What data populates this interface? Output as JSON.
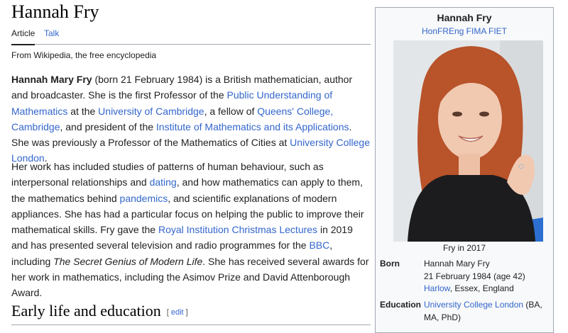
{
  "article": {
    "title": "Hannah Fry",
    "tabs": {
      "article": "Article",
      "talk": "Talk"
    },
    "tagline": "From Wikipedia, the free encyclopedia"
  },
  "p1": [
    {
      "t": "Hannah Mary Fry",
      "b": true
    },
    {
      "t": " (born 21 February 1984) is a British mathematician, author and broadcaster. She is the first Professor of the "
    },
    {
      "t": "Public Understanding of Mathematics",
      "link": true
    },
    {
      "t": " at the "
    },
    {
      "t": "University of Cambridge",
      "link": true
    },
    {
      "t": ", a fellow of "
    },
    {
      "t": "Queens' College, Cambridge",
      "link": true
    },
    {
      "t": ", and president of the "
    },
    {
      "t": "Institute of Mathematics and its Applications",
      "link": true
    },
    {
      "t": ". She was previously a Professor of the Mathematics of Cities at "
    },
    {
      "t": "University College London",
      "link": true
    },
    {
      "t": "."
    }
  ],
  "p2": [
    {
      "t": "Her work has included studies of patterns of human behaviour, such as interpersonal relationships and "
    },
    {
      "t": "dating",
      "link": true
    },
    {
      "t": ", and how mathematics can apply to them, the mathematics behind "
    },
    {
      "t": "pandemics",
      "link": true
    },
    {
      "t": ", and scientific explanations of modern appliances. She has had a particular focus on helping the public to improve their mathematical skills. Fry gave the "
    },
    {
      "t": "Royal Institution Christmas Lectures",
      "link": true
    },
    {
      "t": " in 2019 and has presented several television and radio programmes for the "
    },
    {
      "t": "BBC",
      "link": true
    },
    {
      "t": ", including "
    },
    {
      "t": "The Secret Genius of Modern Life",
      "i": true
    },
    {
      "t": ". She has received several awards for her work in mathematics, including the Asimov Prize and David Attenborough Award."
    }
  ],
  "section": {
    "title": "Early life and education",
    "edit_open": "[ ",
    "edit": "edit",
    "edit_close": " ]"
  },
  "infobox": {
    "name": "Hannah Fry",
    "honors": "HonFREng FIMA FIET",
    "caption": "Fry in 2017",
    "born_label": "Born",
    "born_name": "Hannah Mary Fry",
    "born_date": "21 February 1984 (age 42)",
    "born_place_link": "Harlow",
    "born_place_rest": ", Essex, England",
    "education_label": "Education",
    "education_link": "University College London",
    "education_rest": " (BA, MA, PhD)"
  }
}
